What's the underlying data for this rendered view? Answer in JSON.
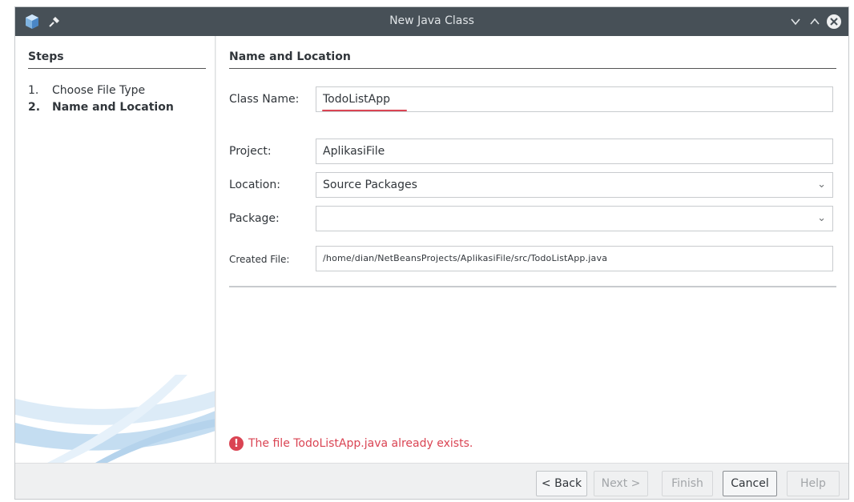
{
  "window": {
    "title": "New Java Class"
  },
  "steps": {
    "header": "Steps",
    "items": [
      {
        "num": "1.",
        "label": "Choose File Type",
        "current": false
      },
      {
        "num": "2.",
        "label": "Name and Location",
        "current": true
      }
    ]
  },
  "form": {
    "section_title": "Name and Location",
    "class_name_label": "Class Name:",
    "class_name_value": "TodoListApp",
    "project_label": "Project:",
    "project_value": "AplikasiFile",
    "location_label": "Location:",
    "location_value": "Source Packages",
    "package_label": "Package:",
    "package_value": "",
    "created_file_label": "Created File:",
    "created_file_value": "/home/dian/NetBeansProjects/AplikasiFile/src/TodoListApp.java"
  },
  "error": {
    "message": "The file TodoListApp.java already exists.",
    "color": "#da4453"
  },
  "buttons": {
    "back": "< Back",
    "next": "Next >",
    "finish": "Finish",
    "cancel": "Cancel",
    "help": "Help"
  },
  "icons": {
    "app": "netbeans-cube-icon",
    "pin": "pin-icon",
    "minimize": "chevron-down-icon",
    "maximize": "chevron-up-icon",
    "close": "close-icon",
    "error": "error-icon"
  }
}
